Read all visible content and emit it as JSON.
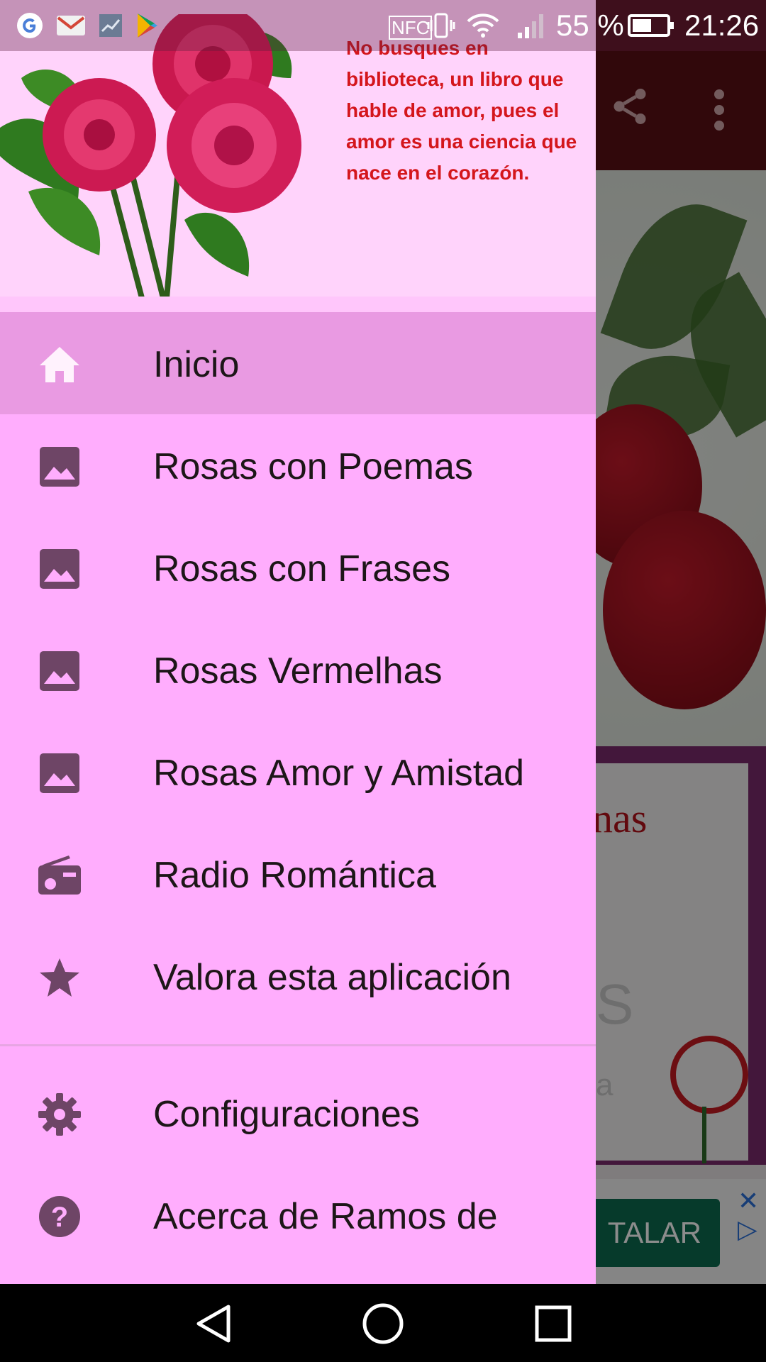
{
  "status_bar": {
    "icons": [
      "google-icon",
      "gmail-icon",
      "stocks-icon",
      "play-store-icon",
      "nfc-icon",
      "vibrate-icon",
      "wifi-icon",
      "signal-icon",
      "battery-icon"
    ],
    "nfc_label": "NFC",
    "battery_percent": "55 %",
    "battery_level": 0.55,
    "time": "21:26"
  },
  "background_app": {
    "card_title_fragment": "nas",
    "card_letter": "S",
    "card_small_letter": "a",
    "ad_button_label": "TALAR",
    "colors": {
      "toolbar": "#5a0f14",
      "card_area": "#7b2b6c",
      "ad_button": "#0b6b4f"
    }
  },
  "drawer": {
    "header_quote": "No busques en biblioteca, un libro que hable de amor, pues el amor es una ciencia que nace en el corazón.",
    "colors": {
      "background": "#ffadfd",
      "selected": "#e99ae2",
      "icon": "#6e4566",
      "selected_icon": "#fff2fd",
      "quote_text": "#d4161c"
    },
    "items": [
      {
        "label": "Inicio",
        "icon": "home-icon",
        "selected": true
      },
      {
        "label": "Rosas con Poemas",
        "icon": "image-icon"
      },
      {
        "label": "Rosas con Frases",
        "icon": "image-icon"
      },
      {
        "label": "Rosas Vermelhas",
        "icon": "image-icon"
      },
      {
        "label": "Rosas Amor y Amistad",
        "icon": "image-icon"
      },
      {
        "label": "Radio Romántica",
        "icon": "radio-icon"
      },
      {
        "label": "Valora esta aplicación",
        "icon": "star-icon"
      }
    ],
    "secondary_items": [
      {
        "label": "Configuraciones",
        "icon": "gear-icon"
      },
      {
        "label": "Acerca de Ramos de",
        "icon": "help-icon"
      }
    ]
  },
  "system_nav": {
    "buttons": [
      "back-icon",
      "home-circle-icon",
      "recents-icon"
    ]
  }
}
